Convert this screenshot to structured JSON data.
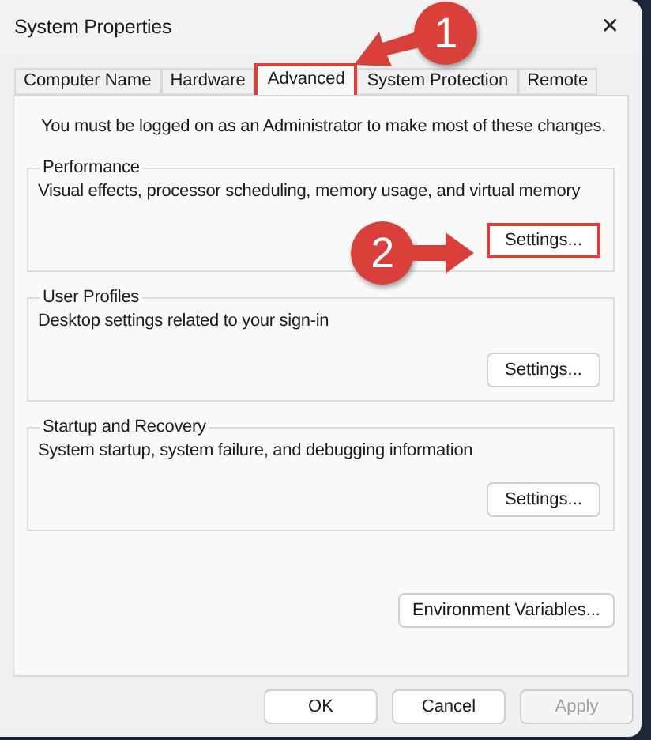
{
  "window": {
    "title": "System Properties",
    "close": "✕"
  },
  "tabs": [
    {
      "label": "Computer Name",
      "selected": false,
      "highlighted": false
    },
    {
      "label": "Hardware",
      "selected": false,
      "highlighted": false
    },
    {
      "label": "Advanced",
      "selected": true,
      "highlighted": true
    },
    {
      "label": "System Protection",
      "selected": false,
      "highlighted": false
    },
    {
      "label": "Remote",
      "selected": false,
      "highlighted": false
    }
  ],
  "notice": "You must be logged on as an Administrator to make most of these changes.",
  "groups": [
    {
      "title": "Performance",
      "description": "Visual effects, processor scheduling, memory usage, and virtual memory",
      "button": {
        "label": "Settings...",
        "highlighted": true
      }
    },
    {
      "title": "User Profiles",
      "description": "Desktop settings related to your sign-in",
      "button": {
        "label": "Settings...",
        "highlighted": false
      }
    },
    {
      "title": "Startup and Recovery",
      "description": "System startup, system failure, and debugging information",
      "button": {
        "label": "Settings...",
        "highlighted": false
      }
    }
  ],
  "extra_button": {
    "label": "Environment Variables...",
    "highlighted": false
  },
  "buttons": [
    {
      "label": "OK",
      "disabled": false
    },
    {
      "label": "Cancel",
      "disabled": false
    },
    {
      "label": "Apply",
      "disabled": true
    }
  ],
  "callouts": [
    {
      "number": "1",
      "kind": "diagonal"
    },
    {
      "number": "2",
      "kind": "straight"
    }
  ]
}
